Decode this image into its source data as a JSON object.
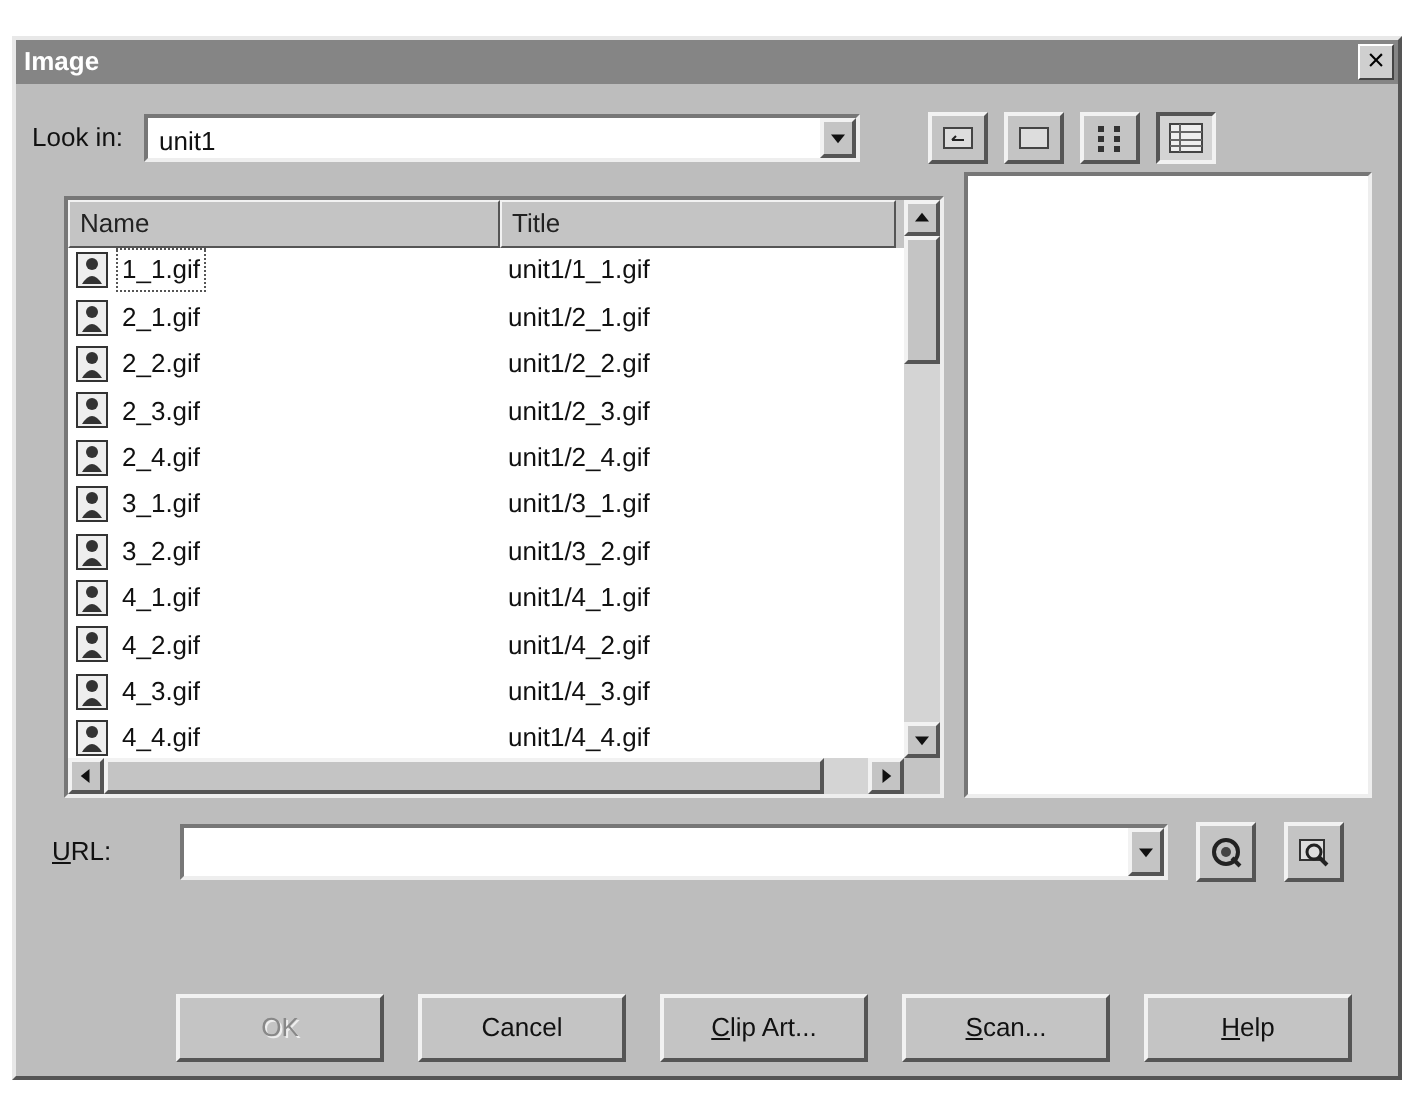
{
  "window": {
    "title": "Image",
    "close": "×"
  },
  "look_in": {
    "label": "Look in:",
    "value": "unit1"
  },
  "toolbar": [
    {
      "kind": "up"
    },
    {
      "kind": "newfolder"
    },
    {
      "kind": "list",
      "selected": false
    },
    {
      "kind": "details",
      "selected": true
    }
  ],
  "file_list": {
    "columns": [
      "Name",
      "Title"
    ],
    "rows": [
      {
        "name": "1_1.gif",
        "title": "unit1/1_1.gif",
        "selected": true
      },
      {
        "name": "2_1.gif",
        "title": "unit1/2_1.gif",
        "selected": false
      },
      {
        "name": "2_2.gif",
        "title": "unit1/2_2.gif",
        "selected": false
      },
      {
        "name": "2_3.gif",
        "title": "unit1/2_3.gif",
        "selected": false
      },
      {
        "name": "2_4.gif",
        "title": "unit1/2_4.gif",
        "selected": false
      },
      {
        "name": "3_1.gif",
        "title": "unit1/3_1.gif",
        "selected": false
      },
      {
        "name": "3_2.gif",
        "title": "unit1/3_2.gif",
        "selected": false
      },
      {
        "name": "4_1.gif",
        "title": "unit1/4_1.gif",
        "selected": false
      },
      {
        "name": "4_2.gif",
        "title": "unit1/4_2.gif",
        "selected": false
      },
      {
        "name": "4_3.gif",
        "title": "unit1/4_3.gif",
        "selected": false
      },
      {
        "name": "4_4.gif",
        "title": "unit1/4_4.gif",
        "selected": false
      }
    ]
  },
  "url": {
    "label_parts": [
      {
        "text": "U",
        "underlined": true
      },
      {
        "text": "RL:",
        "underlined": false
      }
    ]
  },
  "buttons": [
    {
      "label": "OK",
      "disabled": true
    },
    {
      "label": "Cancel",
      "disabled": false
    },
    {
      "label_parts": [
        {
          "text": "C",
          "underlined": true
        },
        {
          "text": "lip Art...",
          "underlined": false
        }
      ],
      "disabled": false
    },
    {
      "label_parts": [
        {
          "text": "S",
          "underlined": true
        },
        {
          "text": "can...",
          "underlined": false
        }
      ],
      "disabled": false
    },
    {
      "label_parts": [
        {
          "text": "H",
          "underlined": true
        },
        {
          "text": "elp",
          "underlined": false
        }
      ],
      "disabled": false
    }
  ]
}
